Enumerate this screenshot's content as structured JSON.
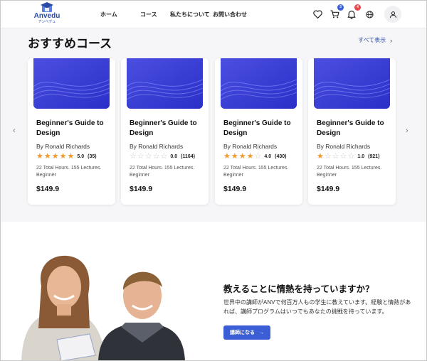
{
  "brand": {
    "name": "Anvedu",
    "sub": "アンベデュ",
    "color": "#2b4aa6"
  },
  "nav": [
    {
      "label": "ホーム"
    },
    {
      "label": "コース"
    },
    {
      "label": "私たちについて"
    },
    {
      "label": "お問い合わせ"
    }
  ],
  "header_icons": {
    "wishlist": "heart-icon",
    "cart": {
      "icon": "cart-icon",
      "badge": "3",
      "badge_color": "#3b5ed6"
    },
    "notifications": {
      "icon": "bell-icon",
      "badge": "4",
      "badge_color": "#e5484d"
    },
    "language": "globe-icon",
    "profile": "user-icon"
  },
  "courses_section": {
    "title": "おすすめコース",
    "view_all": "すべて表示",
    "prev_icon": "chevron-left-icon",
    "next_icon": "chevron-right-icon",
    "star_color": "#f29a2e",
    "cards": [
      {
        "title": "Beginner's Guide to Design",
        "author": "By Ronald Richards",
        "rating": 5,
        "score": "5.0",
        "reviews": "(35)",
        "meta": "22 Total Hours. 155 Lectures. Beginner",
        "price": "$149.9"
      },
      {
        "title": "Beginner's Guide to Design",
        "author": "By Ronald Richards",
        "rating": 0,
        "score": "0.0",
        "reviews": "(1164)",
        "meta": "22 Total Hours. 155 Lectures. Beginner",
        "price": "$149.9"
      },
      {
        "title": "Beginner's Guide to Design",
        "author": "By Ronald Richards",
        "rating": 4,
        "score": "4.0",
        "reviews": "(430)",
        "meta": "22 Total Hours. 155 Lectures. Beginner",
        "price": "$149.9"
      },
      {
        "title": "Beginner's Guide to Design",
        "author": "By Ronald Richards",
        "rating": 1,
        "score": "1.0",
        "reviews": "(921)",
        "meta": "22 Total Hours. 155 Lectures. Beginner",
        "price": "$149.9"
      }
    ]
  },
  "instructor_section": {
    "title": "教えることに情熱を持っていますか？",
    "text": "世界中の講師がANVで何百万人もの学生に教えています。経験と情熱があれば、講師プログラムはいつでもあなたの挑戦を待っています。",
    "button": "講師になる",
    "button_color": "#3b5ed6"
  }
}
